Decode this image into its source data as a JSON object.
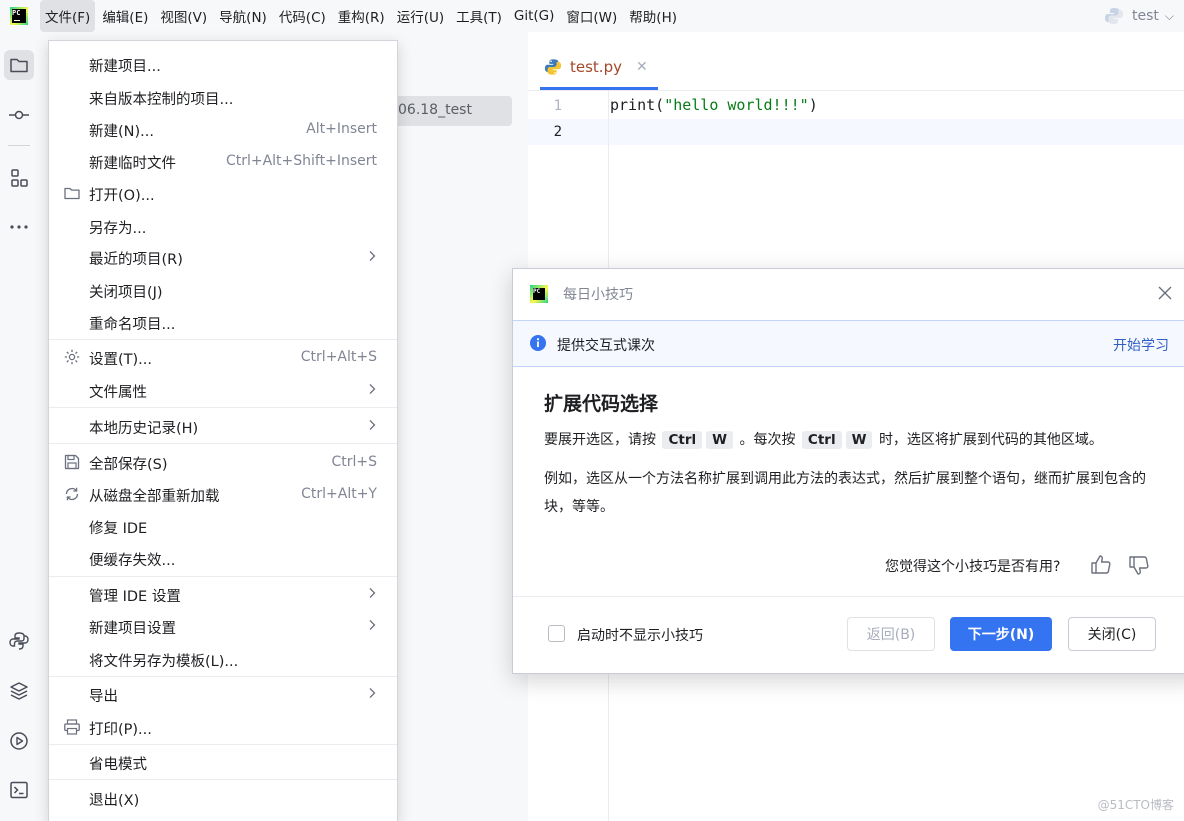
{
  "menubar": {
    "logo_text": "PC",
    "items": [
      "文件(F)",
      "编辑(E)",
      "视图(V)",
      "导航(N)",
      "代码(C)",
      "重构(R)",
      "运行(U)",
      "工具(T)",
      "Git(G)",
      "窗口(W)",
      "帮助(H)"
    ],
    "active_index": 0,
    "project_name": "test"
  },
  "toolstrip": {
    "icons": [
      "folder-icon",
      "commit-icon",
      "structure-icon",
      "more-icon",
      "python-console-icon",
      "layers-icon",
      "run-icon",
      "terminal-icon"
    ]
  },
  "project_panel": {
    "selected_row_text": "06.18_test"
  },
  "editor": {
    "tab_name": "test.py",
    "line_numbers": [
      "1",
      "2"
    ],
    "code_func": "print(",
    "code_string": "\"hello world!!!\"",
    "code_close": ")"
  },
  "file_menu": {
    "items": [
      {
        "label": "新建项目...",
        "shortcut": "",
        "icon": "",
        "submenu": false
      },
      {
        "label": "来自版本控制的项目...",
        "shortcut": "",
        "icon": "",
        "submenu": false
      },
      {
        "label": "新建(N)...",
        "shortcut": "Alt+Insert",
        "icon": "",
        "submenu": false
      },
      {
        "label": "新建临时文件",
        "shortcut": "Ctrl+Alt+Shift+Insert",
        "icon": "",
        "submenu": false
      },
      {
        "label": "打开(O)...",
        "shortcut": "",
        "icon": "folder-icon",
        "submenu": false
      },
      {
        "label": "另存为...",
        "shortcut": "",
        "icon": "",
        "submenu": false
      },
      {
        "label": "最近的项目(R)",
        "shortcut": "",
        "icon": "",
        "submenu": true
      },
      {
        "label": "关闭项目(J)",
        "shortcut": "",
        "icon": "",
        "submenu": false
      },
      {
        "label": "重命名项目...",
        "shortcut": "",
        "icon": "",
        "submenu": false
      },
      {
        "label": "设置(T)...",
        "shortcut": "Ctrl+Alt+S",
        "icon": "gear-icon",
        "submenu": false
      },
      {
        "label": "文件属性",
        "shortcut": "",
        "icon": "",
        "submenu": true
      },
      {
        "label": "本地历史记录(H)",
        "shortcut": "",
        "icon": "",
        "submenu": true
      },
      {
        "label": "全部保存(S)",
        "shortcut": "Ctrl+S",
        "icon": "save-icon",
        "submenu": false
      },
      {
        "label": "从磁盘全部重新加载",
        "shortcut": "Ctrl+Alt+Y",
        "icon": "reload-icon",
        "submenu": false
      },
      {
        "label": "修复 IDE",
        "shortcut": "",
        "icon": "",
        "submenu": false
      },
      {
        "label": "便缓存失效...",
        "shortcut": "",
        "icon": "",
        "submenu": false
      },
      {
        "label": "管理 IDE 设置",
        "shortcut": "",
        "icon": "",
        "submenu": true
      },
      {
        "label": "新建项目设置",
        "shortcut": "",
        "icon": "",
        "submenu": true
      },
      {
        "label": "将文件另存为模板(L)...",
        "shortcut": "",
        "icon": "",
        "submenu": false
      },
      {
        "label": "导出",
        "shortcut": "",
        "icon": "",
        "submenu": true
      },
      {
        "label": "打印(P)...",
        "shortcut": "",
        "icon": "print-icon",
        "submenu": false
      },
      {
        "label": "省电模式",
        "shortcut": "",
        "icon": "",
        "submenu": false
      },
      {
        "label": "退出(X)",
        "shortcut": "",
        "icon": "",
        "submenu": false
      }
    ]
  },
  "tip_dialog": {
    "title_icon_text": "PC",
    "title": "每日小技巧",
    "banner_text": "提供交互式课次",
    "banner_link": "开始学习",
    "heading": "扩展代码选择",
    "p1_before": "要展开选区，请按",
    "p1_key1": "Ctrl",
    "p1_key2": "W",
    "p1_middle": "。每次按",
    "p1_key3": "Ctrl",
    "p1_key4": "W",
    "p1_after": "时，选区将扩展到代码的其他区域。",
    "p2": "例如，选区从一个方法名称扩展到调用此方法的表达式，然后扩展到整个语句，继而扩展到包含的块，等等。",
    "helpful_question": "您觉得这个小技巧是否有用?",
    "dont_show_label": "启动时不显示小技巧",
    "dont_show_checked": false,
    "back_label": "返回(B)",
    "next_label": "下一步(N)",
    "close_label": "关闭(C)"
  },
  "watermark": "@51CTO博客",
  "colors": {
    "accent": "#3574f0",
    "menu_active_bg": "#dfe1e5",
    "tab_file_name": "#a4482b",
    "code_string": "#067d17",
    "link": "#2f5fc4"
  }
}
